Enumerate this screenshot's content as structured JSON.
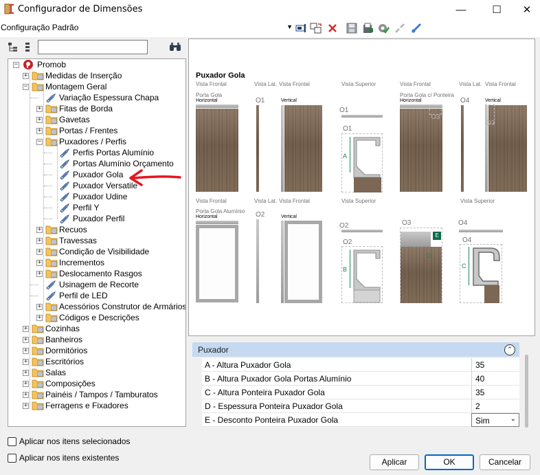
{
  "window": {
    "title": "Configurador de Dimensões",
    "controls": [
      "—",
      "☐",
      "✕"
    ]
  },
  "toolbar": {
    "config_value": "Configuração Padrão",
    "icons": [
      "rename-icon",
      "copy-config-icon",
      "delete-icon",
      "save-icon",
      "export-icon",
      "apply-settings-icon",
      "unlink-icon",
      "link-icon"
    ]
  },
  "tree": {
    "search_placeholder": "",
    "root": "Promob",
    "items": [
      {
        "label": "Medidas de Inserção"
      },
      {
        "label": "Montagem Geral"
      },
      {
        "label": "Variação Espessura Chapa"
      },
      {
        "label": "Fitas de Borda"
      },
      {
        "label": "Gavetas"
      },
      {
        "label": "Portas / Frentes"
      },
      {
        "label": "Puxadores / Perfis"
      },
      {
        "label": "Perfis Portas Alumínio"
      },
      {
        "label": "Portas Alumínio Orçamento"
      },
      {
        "label": "Puxador Gola"
      },
      {
        "label": "Puxador Versatile"
      },
      {
        "label": "Puxador Udine"
      },
      {
        "label": "Perfil Y"
      },
      {
        "label": "Puxador Perfil"
      },
      {
        "label": "Recuos"
      },
      {
        "label": "Travessas"
      },
      {
        "label": "Condição de Visibilidade"
      },
      {
        "label": "Incrementos"
      },
      {
        "label": "Deslocamento Rasgos"
      },
      {
        "label": "Usinagem de Recorte"
      },
      {
        "label": "Perfil de LED"
      },
      {
        "label": "Acessórios Construtor de Armários"
      },
      {
        "label": "Códigos e Descrições"
      },
      {
        "label": "Cozinhas"
      },
      {
        "label": "Banheiros"
      },
      {
        "label": "Dormitórios"
      },
      {
        "label": "Escritórios"
      },
      {
        "label": "Salas"
      },
      {
        "label": "Composições"
      },
      {
        "label": "Painéis / Tampos / Tamburatos"
      },
      {
        "label": "Ferragens e Fixadores"
      }
    ]
  },
  "preview": {
    "title": "Puxador Gola",
    "vista_frontal": "Vista Frontal",
    "vista_lat": "Vista Lat.",
    "vista_superior": "Vista Superior",
    "porta_gola": "Porta Gola",
    "porta_gola_ponteira": "Porta Gola c/ Ponteira",
    "porta_gola_aluminio": "Porta Gola Alumínio",
    "horizontal": "Horizontal",
    "vertical": "Vertical",
    "markers": [
      "O1",
      "O2",
      "O3",
      "O4"
    ],
    "letters": [
      "A",
      "B",
      "C",
      "D",
      "E"
    ]
  },
  "properties": {
    "title": "Puxador",
    "rows": [
      {
        "name": "A - Altura Puxador Gola",
        "value": "35"
      },
      {
        "name": "B - Altura Puxador Gola Portas Alumínio",
        "value": "40"
      },
      {
        "name": "C - Altura Ponteira Puxador Gola",
        "value": "35"
      },
      {
        "name": "D - Espessura Ponteira Puxador Gola",
        "value": "2"
      },
      {
        "name": "E - Desconto Ponteira Puxador Gola",
        "value": "Sim"
      }
    ]
  },
  "options": {
    "apply_selected": "Aplicar nos itens selecionados",
    "apply_existing": "Aplicar nos itens existentes"
  },
  "buttons": {
    "apply": "Aplicar",
    "ok": "OK",
    "cancel": "Cancelar"
  },
  "colors": {
    "accent": "#0067c0",
    "annotation_arrow": "#e8141e",
    "props_header": "#c5d9f1",
    "dimension_green": "#1b8a5a"
  }
}
